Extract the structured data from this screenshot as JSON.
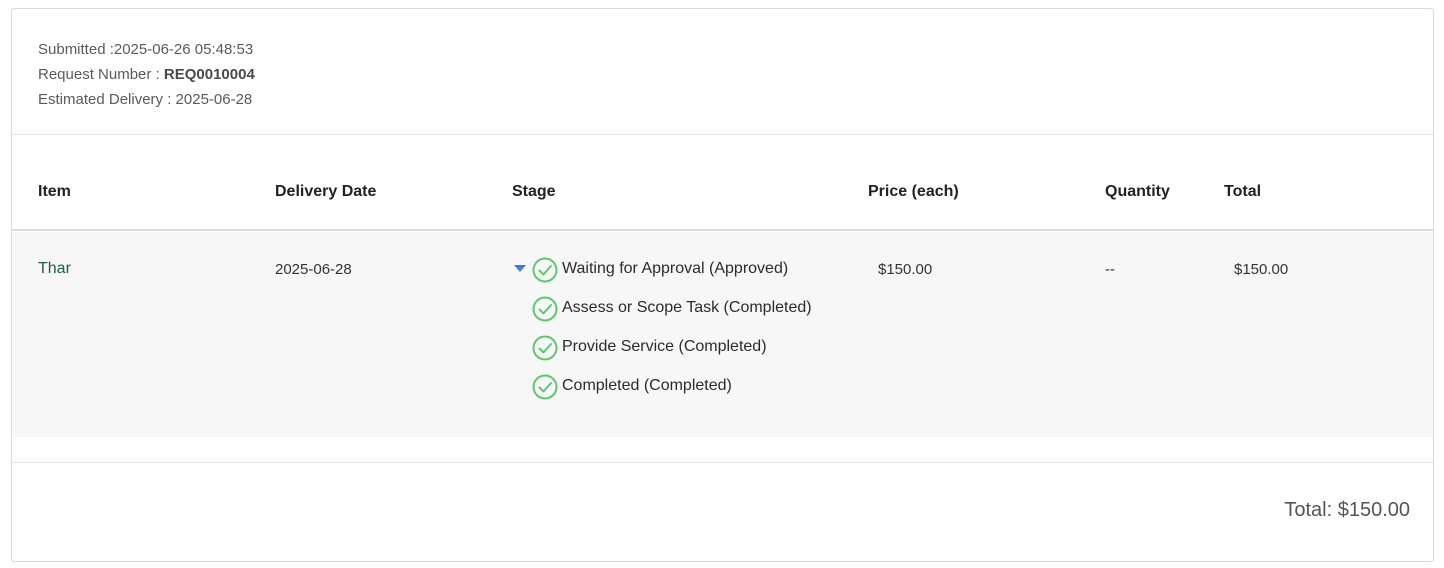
{
  "summary": {
    "submitted_label": "Submitted :",
    "submitted_value": "2025-06-26 05:48:53",
    "request_label": "Request Number : ",
    "request_value": "REQ0010004",
    "delivery_label": "Estimated Delivery : ",
    "delivery_value": "2025-06-28"
  },
  "table": {
    "headers": [
      "Item",
      "Delivery Date",
      "Stage",
      "Price (each)",
      "Quantity",
      "Total"
    ],
    "rows": [
      {
        "item": "Thar",
        "delivery_date": "2025-06-28",
        "stages": [
          "Waiting for Approval (Approved)",
          "Assess or Scope Task (Completed)",
          "Provide Service (Completed)",
          "Completed (Completed)"
        ],
        "price": "$150.00",
        "quantity": "--",
        "total": "$150.00"
      }
    ]
  },
  "footer": {
    "grand_total": "Total: $150.00"
  },
  "colors": {
    "check_green": "#5cc96e",
    "caret_blue": "#3d7fdc",
    "item_link": "#1f5c4a"
  },
  "icons": {
    "stage_status": "check-circle-icon",
    "expand": "caret-down-icon"
  }
}
